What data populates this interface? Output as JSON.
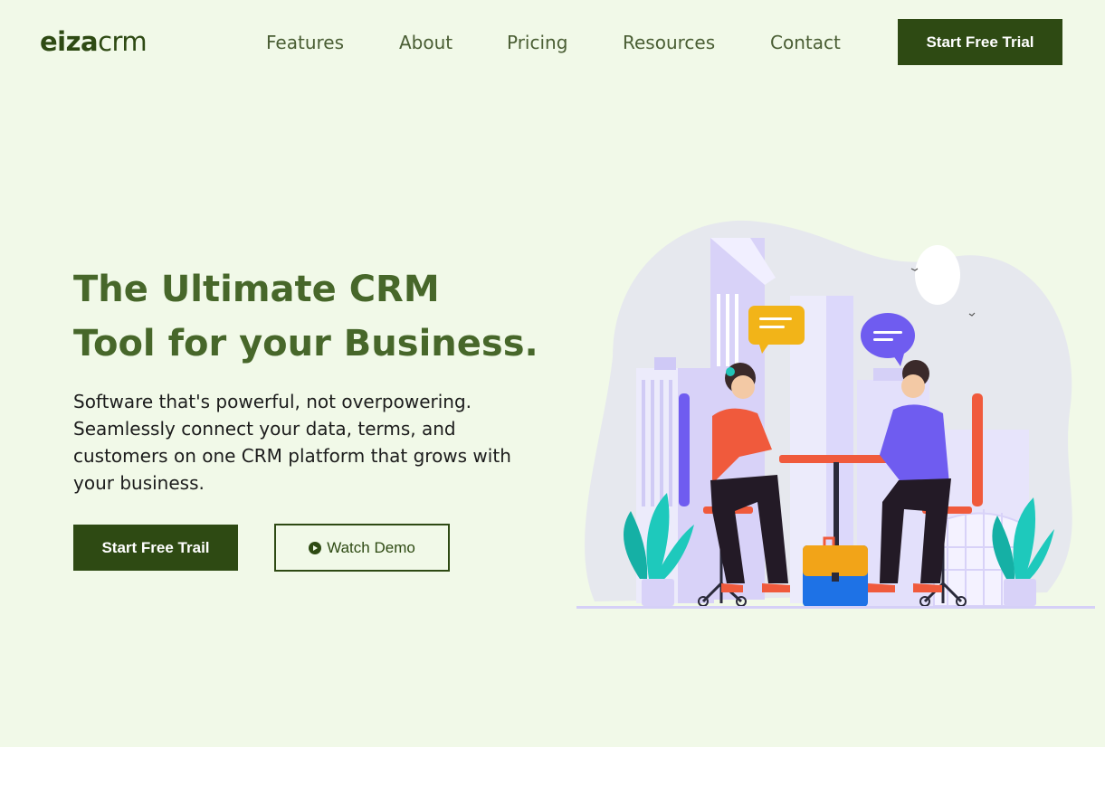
{
  "brand": {
    "logo_bold": "eiza",
    "logo_light": "crm"
  },
  "nav": {
    "items": [
      "Features",
      "About",
      "Pricing",
      "Resources",
      "Contact"
    ],
    "cta": "Start Free Trial"
  },
  "hero": {
    "headline_line1": "The Ultimate CRM",
    "headline_line2": "Tool for your Business.",
    "subtext": "Software that's powerful, not overpowering. Seamlessly connect your data, terms, and customers on one CRM platform that grows with your business.",
    "primary_cta": "Start Free Trail",
    "secondary_cta": "Watch Demo"
  },
  "colors": {
    "brand_dark": "#2e4a13",
    "headline": "#47672a",
    "hero_bg": "#f1f9e8",
    "accent_purple": "#6f5cf0",
    "accent_orange": "#f05a3c"
  }
}
